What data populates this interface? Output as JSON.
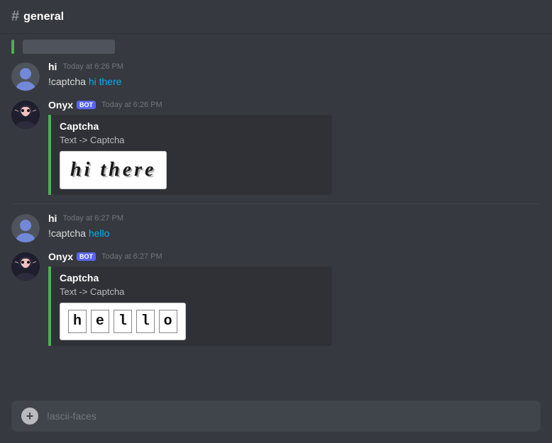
{
  "channel": {
    "hash": "#",
    "name": "general"
  },
  "messages": [
    {
      "id": "msg1",
      "type": "blurred",
      "has_bar": true
    },
    {
      "id": "msg2",
      "type": "user",
      "username": "hi",
      "timestamp": "Today at 6:26 PM",
      "text_plain": "!captcha hi there",
      "text_highlight": "hi there",
      "text_prefix": "!captcha ",
      "command": "!captcha"
    },
    {
      "id": "msg3",
      "type": "bot",
      "username": "Onyx",
      "bot_badge": "BOT",
      "timestamp": "Today at 6:26 PM",
      "embed": {
        "title": "Captcha",
        "description": "Text -> Captcha",
        "captcha_type": "hi_there",
        "captcha_text": "hi there"
      }
    },
    {
      "id": "msg4",
      "type": "user",
      "username": "hi",
      "timestamp": "Today at 6:27 PM",
      "text_plain": "!captcha hello",
      "text_highlight": "hello",
      "text_prefix": "!captcha ",
      "command": "!captcha"
    },
    {
      "id": "msg5",
      "type": "bot",
      "username": "Onyx",
      "bot_badge": "BOT",
      "timestamp": "Today at 6:27 PM",
      "embed": {
        "title": "Captcha",
        "description": "Text -> Captcha",
        "captcha_type": "hello",
        "captcha_text": "hello",
        "captcha_letters": [
          "h",
          "e",
          "l",
          "l",
          "o"
        ]
      }
    }
  ],
  "input": {
    "placeholder": "!ascii-faces",
    "add_button_label": "+"
  }
}
